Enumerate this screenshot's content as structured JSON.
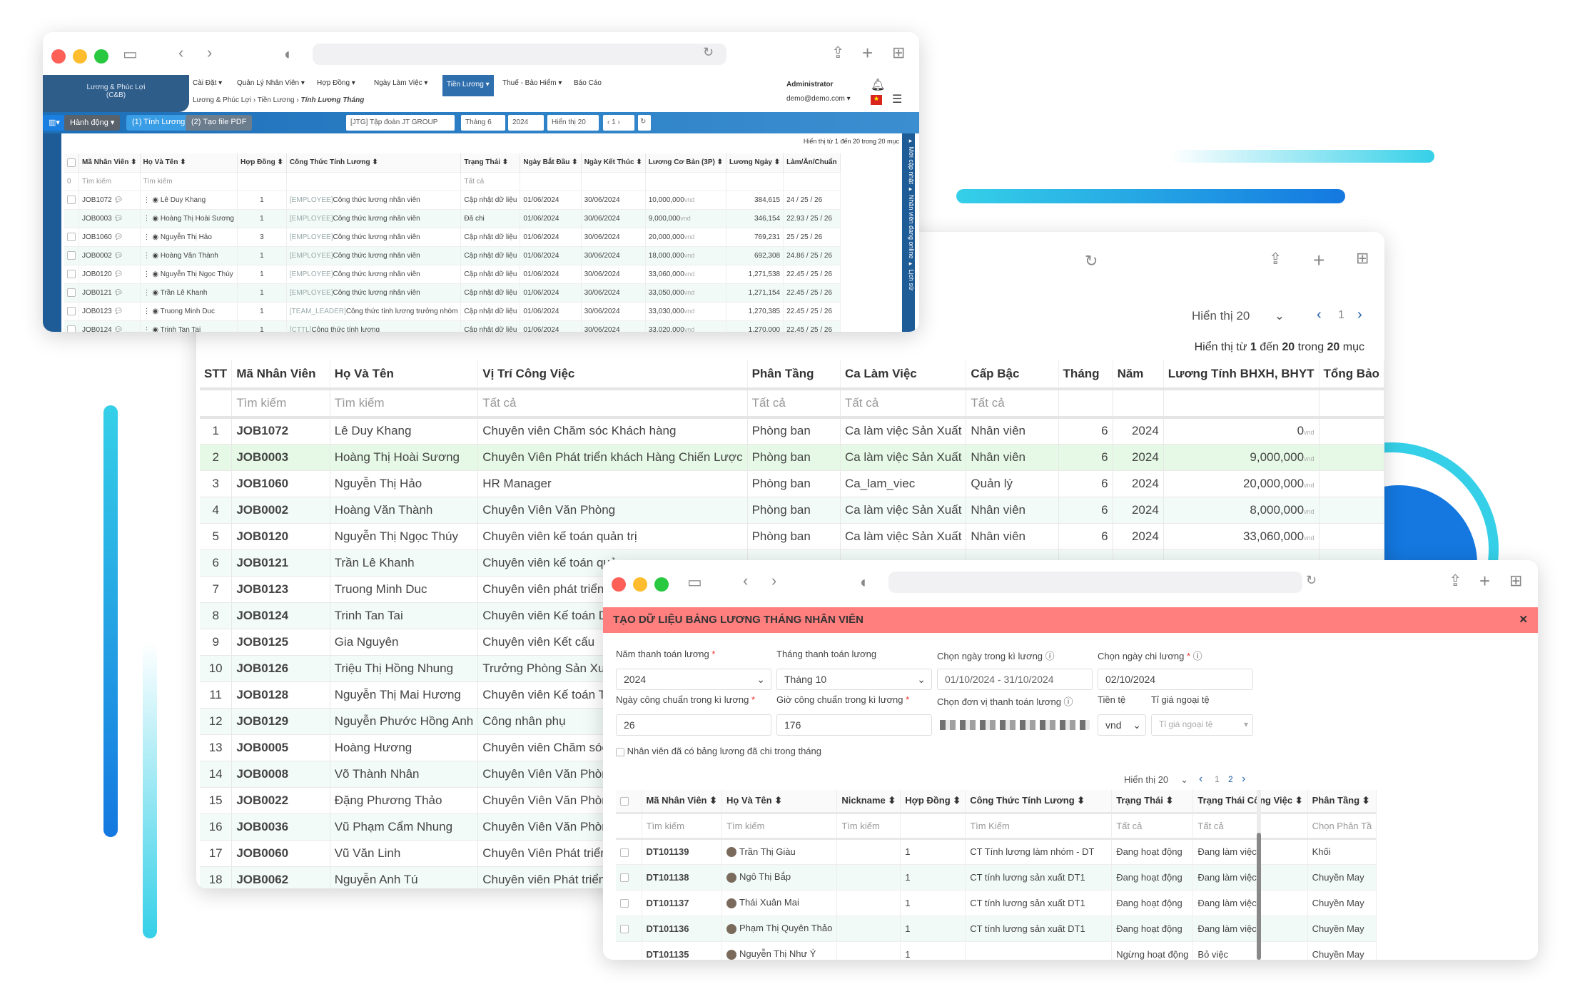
{
  "colors": {
    "accent": "#1d6fb8",
    "modal_header": "#ff7f7f",
    "decor_cyan": "#35d0e8",
    "decor_blue": "#1478e0"
  },
  "top_window": {
    "app": {
      "title_line1": "Lương & Phúc Lợi",
      "title_line2": "(C&B)"
    },
    "menu": [
      "Cài Đặt ▾",
      "Quản Lý Nhân Viên ▾",
      "Hợp Đồng ▾",
      "Ngày Làm Việc ▾",
      "Tiền Lương ▾",
      "Thuế - Bảo Hiểm ▾",
      "Báo Cáo"
    ],
    "active_menu": "Tiền Lương ▾",
    "breadcrumb": [
      "Lương & Phúc Lợi",
      "Tiền Lương",
      "Tính Lương Tháng"
    ],
    "user": {
      "name": "Administrator",
      "email": "demo@demo.com ▾"
    },
    "toolbar": {
      "action": "Hành động ▾",
      "tab1": "(1) Tính Lương",
      "tab2": "(2) Tạo file PDF",
      "company": "[JTG] Tập đoàn JT GROUP",
      "month": "Tháng 6",
      "year": "2024",
      "show": "Hiển thị 20",
      "page": "1"
    },
    "summary": "Hiển thị từ 1 đến 20 trong 20 mục",
    "side_tabs": "▸ Mới cập nhật  ▸ Nhân viên đang online  ▸ Lịch sử",
    "columns": [
      "Mã Nhân Viên ⬍",
      "Họ Và Tên ⬍",
      "Hợp Đồng ⬍",
      "Công Thức Tính Lương ⬍",
      "Trạng Thái ⬍",
      "Ngày Bắt Đầu ⬍",
      "Ngày Kết Thúc ⬍",
      "Lương Cơ Bản (3P) ⬍",
      "Lương Ngày ⬍",
      "Làm/Ăn/Chuẩn"
    ],
    "filters": {
      "count": "0",
      "search1": "Tìm kiếm",
      "search2": "Tìm kiếm",
      "status": "Tất cả"
    },
    "rows": [
      {
        "id": "JOB1072",
        "name": "Lê Duy Khang",
        "contract": "1",
        "tag": "[EMPLOYEE]",
        "formula": "Công thức lương nhân viên",
        "status": "Cập nhật dữ liệu",
        "start": "01/06/2024",
        "end": "30/06/2024",
        "base": "10,000,000",
        "daily": "384,615",
        "ratio": "24 / 25 / 26"
      },
      {
        "id": "JOB0003",
        "name": "Hoàng Thị Hoài Sương",
        "contract": "1",
        "tag": "[EMPLOYEE]",
        "formula": "Công thức lương nhân viên",
        "status": "Đã chi",
        "start": "01/06/2024",
        "end": "30/06/2024",
        "base": "9,000,000",
        "daily": "346,154",
        "ratio": "22.93 / 25 / 26"
      },
      {
        "id": "JOB1060",
        "name": "Nguyễn Thị Hảo",
        "contract": "3",
        "tag": "[EMPLOYEE]",
        "formula": "Công thức lương nhân viên",
        "status": "Cập nhật dữ liệu",
        "start": "01/06/2024",
        "end": "30/06/2024",
        "base": "20,000,000",
        "daily": "769,231",
        "ratio": "25 / 25 / 26"
      },
      {
        "id": "JOB0002",
        "name": "Hoàng Văn Thành",
        "contract": "1",
        "tag": "[EMPLOYEE]",
        "formula": "Công thức lương nhân viên",
        "status": "Cập nhật dữ liệu",
        "start": "01/06/2024",
        "end": "30/06/2024",
        "base": "18,000,000",
        "daily": "692,308",
        "ratio": "24.86 / 25 / 26"
      },
      {
        "id": "JOB0120",
        "name": "Nguyễn Thị Ngọc Thúy",
        "contract": "1",
        "tag": "[EMPLOYEE]",
        "formula": "Công thức lương nhân viên",
        "status": "Cập nhật dữ liệu",
        "start": "01/06/2024",
        "end": "30/06/2024",
        "base": "33,060,000",
        "daily": "1,271,538",
        "ratio": "22.45 / 25 / 26"
      },
      {
        "id": "JOB0121",
        "name": "Trần Lê Khanh",
        "contract": "1",
        "tag": "[EMPLOYEE]",
        "formula": "Công thức lương nhân viên",
        "status": "Cập nhật dữ liệu",
        "start": "01/06/2024",
        "end": "30/06/2024",
        "base": "33,050,000",
        "daily": "1,271,154",
        "ratio": "22.45 / 25 / 26"
      },
      {
        "id": "JOB0123",
        "name": "Truong Minh Duc",
        "contract": "1",
        "tag": "[TEAM_LEADER]",
        "formula": "Công thức tính lương trưởng nhóm",
        "status": "Cập nhật dữ liệu",
        "start": "01/06/2024",
        "end": "30/06/2024",
        "base": "33,030,000",
        "daily": "1,270,385",
        "ratio": "22.45 / 25 / 26"
      },
      {
        "id": "JOB0124",
        "name": "Trinh Tan Tai",
        "contract": "1",
        "tag": "[CTTL]",
        "formula": "Công thức tính lương",
        "status": "Cập nhật dữ liệu",
        "start": "01/06/2024",
        "end": "30/06/2024",
        "base": "33,020,000",
        "daily": "1,270,000",
        "ratio": "22.45 / 25 / 26"
      }
    ],
    "currency": "vnd"
  },
  "middle_window": {
    "show": "Hiển thị 20",
    "page": "1",
    "summary_pre": "Hiển thị từ ",
    "summary_from": "1",
    "summary_mid": " đến ",
    "summary_to": "20",
    "summary_mid2": " trong ",
    "summary_total": "20",
    "summary_post": " mục",
    "columns": [
      "STT",
      "Mã Nhân Viên",
      "Họ Và Tên",
      "Vị Trí Công Việc",
      "Phân Tầng",
      "Ca Làm Việc",
      "Cấp Bậc",
      "Tháng",
      "Năm",
      "Lương Tính BHXH, BHYT",
      "Tổng Bảo"
    ],
    "filters": [
      "",
      "Tìm kiếm",
      "Tìm kiếm",
      "Tất cả",
      "Tất cả",
      "Tất cả",
      "Tất cả",
      "",
      "",
      "",
      ""
    ],
    "currency": "vnd",
    "rows": [
      [
        "1",
        "JOB1072",
        "Lê Duy Khang",
        "Chuyên viên Chăm sóc Khách hàng",
        "Phòng ban",
        "Ca làm việc Sản Xuất",
        "Nhân viên",
        "6",
        "2024",
        "0",
        ""
      ],
      [
        "2",
        "JOB0003",
        "Hoàng Thị Hoài Sương",
        "Chuyên Viên Phát triển khách Hàng Chiến Lược",
        "Phòng ban",
        "Ca làm việc Sản Xuất",
        "Nhân viên",
        "6",
        "2024",
        "9,000,000",
        ""
      ],
      [
        "3",
        "JOB1060",
        "Nguyễn Thị Hảo",
        "HR Manager",
        "Phòng ban",
        "Ca_lam_viec",
        "Quản lý",
        "6",
        "2024",
        "20,000,000",
        ""
      ],
      [
        "4",
        "JOB0002",
        "Hoàng Văn Thành",
        "Chuyên Viên Văn Phòng",
        "Phòng ban",
        "Ca làm việc Sản Xuất",
        "Nhân viên",
        "6",
        "2024",
        "8,000,000",
        ""
      ],
      [
        "5",
        "JOB0120",
        "Nguyễn Thị Ngọc Thúy",
        "Chuyên viên kế toán quản trị",
        "Phòng ban",
        "Ca làm việc Sản Xuất",
        "Nhân viên",
        "6",
        "2024",
        "33,060,000",
        ""
      ],
      [
        "6",
        "JOB0121",
        "Trần Lê Khanh",
        "Chuyên viên kế toán quản",
        "",
        "",
        "",
        "",
        "",
        "",
        ""
      ],
      [
        "7",
        "JOB0123",
        "Truong Minh Duc",
        "Chuyên viên phát triển p",
        "",
        "",
        "",
        "",
        "",
        "",
        ""
      ],
      [
        "8",
        "JOB0124",
        "Trinh Tan Tai",
        "Chuyên viên Kế toán Dự",
        "",
        "",
        "",
        "",
        "",
        "",
        ""
      ],
      [
        "9",
        "JOB0125",
        "Gia Nguyên",
        "Chuyên viên Kết cấu",
        "",
        "",
        "",
        "",
        "",
        "",
        ""
      ],
      [
        "10",
        "JOB0126",
        "Triệu Thị Hồng Nhung",
        "Trưởng Phòng Sản Xuất",
        "",
        "",
        "",
        "",
        "",
        "",
        ""
      ],
      [
        "11",
        "JOB0128",
        "Nguyễn Thị Mai Hương",
        "Chuyên viên Kế toán Tổn",
        "",
        "",
        "",
        "",
        "",
        "",
        ""
      ],
      [
        "12",
        "JOB0129",
        "Nguyễn Phước Hồng Anh",
        "Công nhân phụ",
        "",
        "",
        "",
        "",
        "",
        "",
        ""
      ],
      [
        "13",
        "JOB0005",
        "Hoàng Hương",
        "Chuyên viên Chăm sóc K",
        "",
        "",
        "",
        "",
        "",
        "",
        ""
      ],
      [
        "14",
        "JOB0008",
        "Võ Thành Nhân",
        "Chuyên Viên Văn Phòng",
        "",
        "",
        "",
        "",
        "",
        "",
        ""
      ],
      [
        "15",
        "JOB0022",
        "Đặng Phương Thảo",
        "Chuyên Viên Văn Phòng",
        "",
        "",
        "",
        "",
        "",
        "",
        ""
      ],
      [
        "16",
        "JOB0036",
        "Vũ Phạm Cẩm Nhung",
        "Chuyên Viên Văn Phòng",
        "",
        "",
        "",
        "",
        "",
        "",
        ""
      ],
      [
        "17",
        "JOB0060",
        "Vũ Văn Linh",
        "Chuyên Viên Phát triển k",
        "",
        "",
        "",
        "",
        "",
        "",
        ""
      ],
      [
        "18",
        "JOB0062",
        "Nguyễn Anh Tú",
        "Chuyên viên Phát triển K",
        "",
        "",
        "",
        "",
        "",
        "",
        ""
      ]
    ]
  },
  "modal": {
    "title": "TẠO DỮ LIỆU BẢNG LƯƠNG THÁNG NHÂN VIÊN",
    "close": "✕",
    "fields": {
      "year_label": "Năm thanh toán lương",
      "year": "2024",
      "month_label": "Tháng thanh toán lương",
      "month": "Tháng 10",
      "period_label": "Chọn ngày trong kì lương",
      "period": "01/10/2024 - 31/10/2024",
      "pay_date_label": "Chọn ngày chi lương",
      "pay_date": "02/10/2024",
      "std_days_label": "Ngày công chuẩn trong kì lương",
      "std_days": "26",
      "std_hours_label": "Giờ công chuẩn trong kì lương",
      "std_hours": "176",
      "unit_label": "Chọn đơn vị thanh toán lương",
      "currency_label": "Tiền tệ",
      "currency": "vnd",
      "rate_label": "Tỉ giá ngoại tệ",
      "rate_placeholder": "Tỉ giá ngoại tệ",
      "paid_checkbox": "Nhân viên đã có bảng lương đã chi trong tháng"
    },
    "show": "Hiển thị 20",
    "pages": [
      "1",
      "2"
    ],
    "columns": [
      "Mã Nhân Viên ⬍",
      "Họ Và Tên ⬍",
      "Nickname ⬍",
      "Hợp Đồng ⬍",
      "Công Thức Tính Lương ⬍",
      "Trạng Thái ⬍",
      "Trạng Thái Công Việc ⬍",
      "Phân Tầng ⬍"
    ],
    "filters": [
      "Tìm kiếm",
      "Tìm kiếm",
      "Tìm kiếm",
      "",
      "Tìm Kiếm",
      "Tất cả",
      "Tất cả",
      "Chọn Phân Tầ"
    ],
    "rows": [
      {
        "id": "DT101139",
        "name": "Trần Thị Giàu",
        "nick": "",
        "contract": "1",
        "formula": "CT Tính lương làm nhóm - DT",
        "status": "Đang hoạt động",
        "work": "Đang làm việc",
        "tier": "Khối",
        "active": true
      },
      {
        "id": "DT101138",
        "name": "Ngô Thị Bắp",
        "nick": "",
        "contract": "1",
        "formula": "CT tính lương sản xuất DT1",
        "status": "Đang hoạt động",
        "work": "Đang làm việc",
        "tier": "Chuyền May",
        "active": true
      },
      {
        "id": "DT101137",
        "name": "Thái Xuân Mai",
        "nick": "",
        "contract": "1",
        "formula": "CT tính lương sản xuất DT1",
        "status": "Đang hoạt động",
        "work": "Đang làm việc",
        "tier": "Chuyền May",
        "active": true
      },
      {
        "id": "DT101136",
        "name": "Phạm Thị Quyên Thảo",
        "nick": "",
        "contract": "1",
        "formula": "CT tính lương sản xuất DT1",
        "status": "Đang hoạt động",
        "work": "Đang làm việc",
        "tier": "Chuyền May",
        "active": true
      },
      {
        "id": "DT101135",
        "name": "Nguyễn Thị Như Ý",
        "nick": "",
        "contract": "1",
        "formula": "",
        "status": "Ngừng hoạt động",
        "work": "Bỏ việc",
        "tier": "Chuyền May",
        "active": false
      }
    ]
  }
}
